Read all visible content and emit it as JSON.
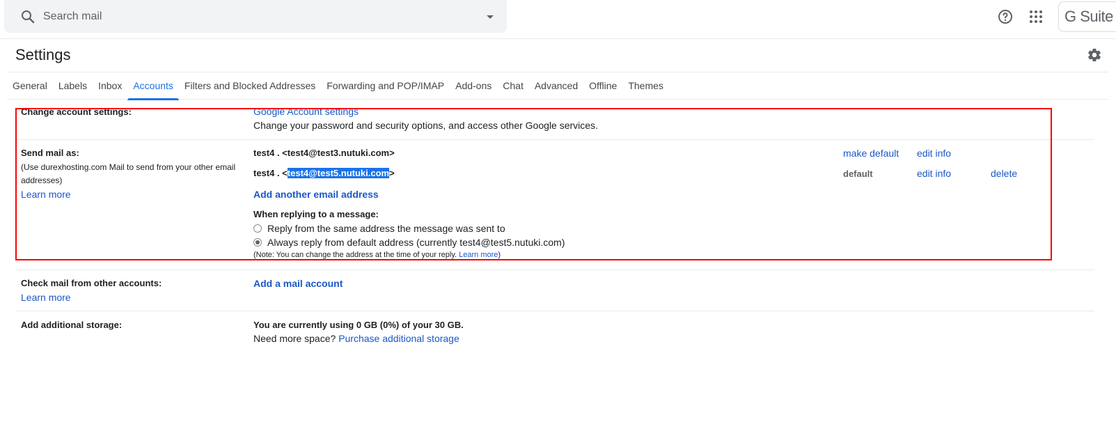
{
  "search": {
    "placeholder": "Search mail"
  },
  "header": {
    "gsuite_label": "G Suite"
  },
  "page_title": "Settings",
  "tabs": [
    {
      "label": "General",
      "active": false
    },
    {
      "label": "Labels",
      "active": false
    },
    {
      "label": "Inbox",
      "active": false
    },
    {
      "label": "Accounts",
      "active": true
    },
    {
      "label": "Filters and Blocked Addresses",
      "active": false
    },
    {
      "label": "Forwarding and POP/IMAP",
      "active": false
    },
    {
      "label": "Add-ons",
      "active": false
    },
    {
      "label": "Chat",
      "active": false
    },
    {
      "label": "Advanced",
      "active": false
    },
    {
      "label": "Offline",
      "active": false
    },
    {
      "label": "Themes",
      "active": false
    }
  ],
  "change_account": {
    "label": "Change account settings:",
    "link": "Google Account settings",
    "description": "Change your password and security options, and access other Google services."
  },
  "send_mail": {
    "label": "Send mail as:",
    "description": "(Use durexhosting.com Mail to send from your other email addresses)",
    "learn_more": "Learn more",
    "addresses": [
      {
        "name": "test4 . <",
        "email": "test4@test3.nutuki.com",
        "suffix": ">",
        "action1": "make default",
        "action2": "edit info",
        "action3": ""
      },
      {
        "name": "test4 . <",
        "email": "test4@test5.nutuki.com",
        "suffix": ">",
        "action1": "default",
        "action2": "edit info",
        "action3": "delete"
      }
    ],
    "add_address": "Add another email address",
    "reply_heading": "When replying to a message:",
    "reply_options": [
      {
        "label": "Reply from the same address the message was sent to",
        "checked": false
      },
      {
        "label": "Always reply from default address (currently test4@test5.nutuki.com)",
        "checked": true
      }
    ],
    "note": "(Note: You can change the address at the time of your reply.",
    "note_link": "Learn more",
    "note_end": ")"
  },
  "check_mail": {
    "label": "Check mail from other accounts:",
    "learn_more": "Learn more",
    "add_account": "Add a mail account"
  },
  "storage": {
    "label": "Add additional storage:",
    "usage": "You are currently using 0 GB (0%) of your 30 GB.",
    "need_more": "Need more space?",
    "purchase_link": "Purchase additional storage"
  },
  "colors": {
    "accent": "#1a73e8",
    "link": "#1a57c7",
    "highlight_box": "#ff0000"
  }
}
